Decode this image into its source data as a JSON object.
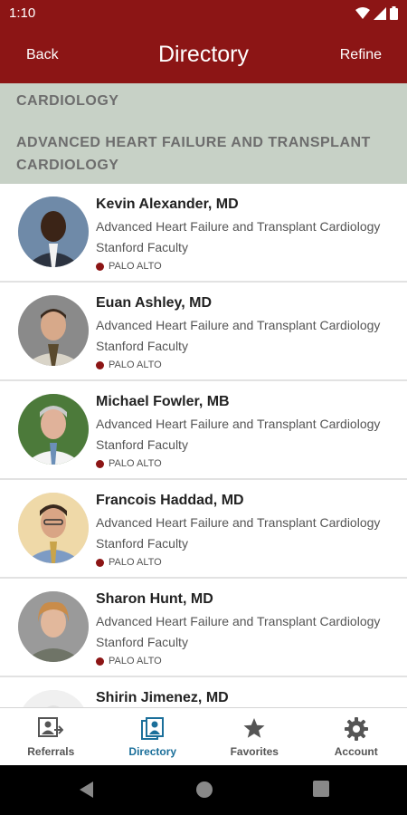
{
  "status_bar": {
    "time": "1:10"
  },
  "header": {
    "back_label": "Back",
    "title": "Directory",
    "refine_label": "Refine"
  },
  "filter": {
    "department": "CARDIOLOGY",
    "subspecialty": "ADVANCED HEART FAILURE AND TRANSPLANT CARDIOLOGY"
  },
  "doctors": [
    {
      "name": "Kevin Alexander, MD",
      "specialty": "Advanced Heart Failure and Transplant Cardiology",
      "affiliation": "Stanford Faculty",
      "location": "PALO ALTO"
    },
    {
      "name": "Euan Ashley, MD",
      "specialty": "Advanced Heart Failure and Transplant Cardiology",
      "affiliation": "Stanford Faculty",
      "location": "PALO ALTO"
    },
    {
      "name": "Michael Fowler, MB",
      "specialty": "Advanced Heart Failure and Transplant Cardiology",
      "affiliation": "Stanford Faculty",
      "location": "PALO ALTO"
    },
    {
      "name": "Francois Haddad, MD",
      "specialty": "Advanced Heart Failure and Transplant Cardiology",
      "affiliation": "Stanford Faculty",
      "location": "PALO ALTO"
    },
    {
      "name": "Sharon Hunt, MD",
      "specialty": "Advanced Heart Failure and Transplant Cardiology",
      "affiliation": "Stanford Faculty",
      "location": "PALO ALTO"
    },
    {
      "name": "Shirin Jimenez, MD"
    }
  ],
  "bottom_nav": [
    {
      "label": "Referrals",
      "icon": "referrals-icon"
    },
    {
      "label": "Directory",
      "icon": "directory-icon",
      "active": true
    },
    {
      "label": "Favorites",
      "icon": "star-icon"
    },
    {
      "label": "Account",
      "icon": "gear-icon"
    }
  ],
  "colors": {
    "brand": "#8c1515",
    "header_bg": "#c7d1c6",
    "active_nav": "#1b6f9a"
  }
}
